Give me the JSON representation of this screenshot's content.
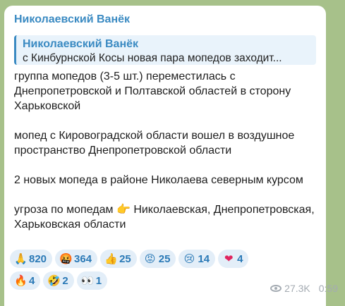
{
  "post": {
    "sender": "Николаевский Ванёк",
    "reply": {
      "name": "Николаевский Ванёк",
      "text": "с Кинбурнской Косы новая пара мопедов заходит..."
    },
    "paragraphs": [
      "группа мопедов (3-5 шт.) переместилась с Днепропетровской и Полтавской областей в сторону Харьковской",
      "мопед с Кировоградской области вошел в воздушное пространство Днепропетровской области",
      "2 новых мопеда в районе Николаева северным курсом"
    ],
    "last_paragraph": {
      "before": "угроза по мопедам",
      "emoji": "👉",
      "after": "Николаевская, Днепропетровская, Харьковская области"
    },
    "reactions_row1": [
      {
        "icon": "🙏",
        "icon_name": "folded-hands-icon",
        "count": "820"
      },
      {
        "icon": "🤬",
        "icon_name": "cursing-face-icon",
        "count": "364"
      },
      {
        "icon": "👍",
        "icon_name": "thumbs-up-icon",
        "count": "25"
      },
      {
        "icon": "😡",
        "icon_name": "angry-face-icon",
        "count": "25"
      },
      {
        "icon": "😢",
        "icon_name": "crying-face-icon",
        "count": "14"
      },
      {
        "icon": "❤",
        "icon_name": "heart-icon",
        "count": "4"
      }
    ],
    "reactions_row2": [
      {
        "icon": "🔥",
        "icon_name": "fire-icon",
        "count": "4"
      },
      {
        "icon": "🤣",
        "icon_name": "rofl-face-icon",
        "count": "2"
      },
      {
        "icon": "👀",
        "icon_name": "eyes-icon",
        "count": "1"
      }
    ],
    "views": "27.3K",
    "time": "0:59"
  },
  "colors": {
    "accent": "#3a8ac2",
    "background": "#a7c18a",
    "reaction_bg": "#e3eef8"
  }
}
